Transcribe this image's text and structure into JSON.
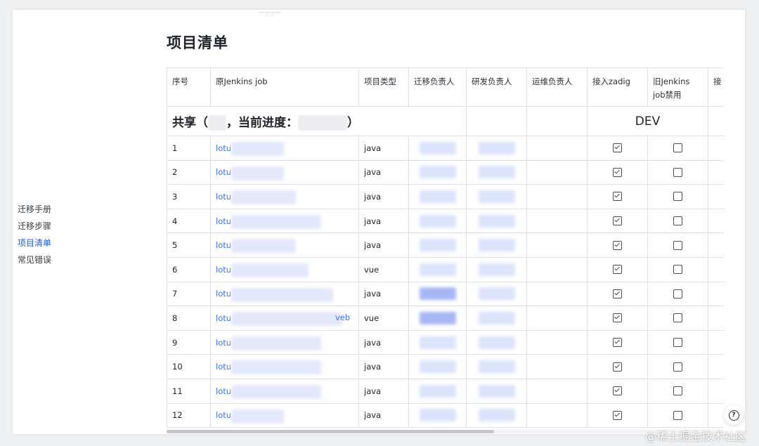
{
  "nav": {
    "items": [
      {
        "label": "迁移手册",
        "active": false
      },
      {
        "label": "迁移步骤",
        "active": false
      },
      {
        "label": "项目清单",
        "active": true
      },
      {
        "label": "常见错误",
        "active": false
      }
    ]
  },
  "page": {
    "title": "项目清单"
  },
  "table": {
    "headers": {
      "seq": "序号",
      "job": "原Jenkins job",
      "type": "项目类型",
      "migrator": "迁移负责人",
      "dev_owner": "研发负责人",
      "ops_owner": "运维负责人",
      "zadig": "接入zadig",
      "old_disabled": "旧Jenkins job禁用",
      "next": "接"
    },
    "group": {
      "prefix": "共享（",
      "middle": "，当前进度：",
      "suffix": "）",
      "env": "DEV"
    },
    "rows": [
      {
        "seq": "1",
        "job": "lotu",
        "job_suffix": "",
        "type": "java",
        "zadig": true,
        "disabled": false
      },
      {
        "seq": "2",
        "job": "lotu",
        "job_suffix": "",
        "type": "java",
        "zadig": true,
        "disabled": false
      },
      {
        "seq": "3",
        "job": "lotu",
        "job_suffix": "",
        "type": "java",
        "zadig": true,
        "disabled": false
      },
      {
        "seq": "4",
        "job": "lotu",
        "job_suffix": "",
        "type": "java",
        "zadig": true,
        "disabled": false
      },
      {
        "seq": "5",
        "job": "lotu",
        "job_suffix": "",
        "type": "java",
        "zadig": true,
        "disabled": false
      },
      {
        "seq": "6",
        "job": "lotu",
        "job_suffix": "",
        "type": "vue",
        "zadig": true,
        "disabled": false
      },
      {
        "seq": "7",
        "job": "lotu",
        "job_suffix": "",
        "type": "java",
        "zadig": true,
        "disabled": false
      },
      {
        "seq": "8",
        "job": "lotu",
        "job_suffix": "veb",
        "type": "vue",
        "zadig": true,
        "disabled": false
      },
      {
        "seq": "9",
        "job": "lotu",
        "job_suffix": "",
        "type": "java",
        "zadig": true,
        "disabled": false
      },
      {
        "seq": "10",
        "job": "lotu",
        "job_suffix": "",
        "type": "java",
        "zadig": true,
        "disabled": false
      },
      {
        "seq": "11",
        "job": "lotu",
        "job_suffix": "",
        "type": "java",
        "zadig": true,
        "disabled": false
      },
      {
        "seq": "12",
        "job": "lotu",
        "job_suffix": "",
        "type": "java",
        "zadig": true,
        "disabled": false
      }
    ]
  },
  "help": {
    "icon": "question-circle-icon",
    "glyph": "?"
  },
  "watermark": "@稀土掘金技术社区",
  "colors": {
    "accent": "#3370ff",
    "active_nav": "#1f5fd1",
    "border": "#dee0e3"
  }
}
